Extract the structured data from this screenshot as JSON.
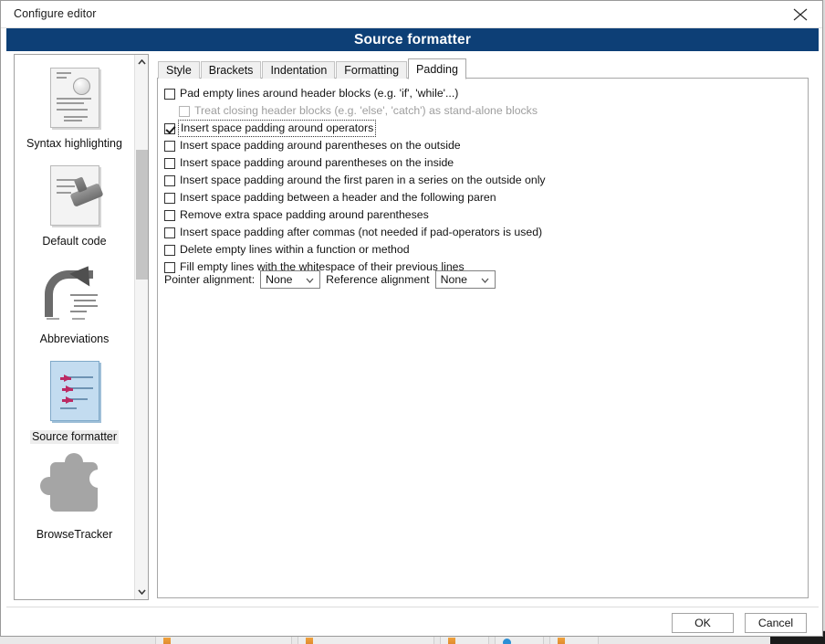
{
  "window": {
    "title": "Configure editor",
    "close_icon": "close-icon",
    "banner_title": "Source formatter"
  },
  "sidebar": {
    "items": [
      {
        "label": "Syntax highlighting",
        "icon": "syntax-highlighting-icon",
        "selected": false
      },
      {
        "label": "Default code",
        "icon": "default-code-icon",
        "selected": false
      },
      {
        "label": "Abbreviations",
        "icon": "abbreviations-icon",
        "selected": false
      },
      {
        "label": "Source formatter",
        "icon": "source-formatter-icon",
        "selected": true
      },
      {
        "label": "BrowseTracker",
        "icon": "browse-tracker-icon",
        "selected": false
      }
    ],
    "scrollbar": {
      "up_arrow": "chevron-up-icon",
      "down_arrow": "chevron-down-icon"
    }
  },
  "tabs": [
    {
      "label": "Style",
      "active": false
    },
    {
      "label": "Brackets",
      "active": false
    },
    {
      "label": "Indentation",
      "active": false
    },
    {
      "label": "Formatting",
      "active": false
    },
    {
      "label": "Padding",
      "active": true
    }
  ],
  "padding_options": [
    {
      "label": "Pad empty lines around header blocks (e.g. 'if', 'while'...)",
      "checked": false,
      "disabled": false,
      "indent": false,
      "focused": false
    },
    {
      "label": "Treat closing header blocks (e.g. 'else', 'catch') as stand-alone blocks",
      "checked": false,
      "disabled": true,
      "indent": true,
      "focused": false
    },
    {
      "label": "Insert space padding around operators",
      "checked": true,
      "disabled": false,
      "indent": false,
      "focused": true
    },
    {
      "label": "Insert space padding around parentheses on the outside",
      "checked": false,
      "disabled": false,
      "indent": false,
      "focused": false
    },
    {
      "label": "Insert space padding around parentheses on the inside",
      "checked": false,
      "disabled": false,
      "indent": false,
      "focused": false
    },
    {
      "label": "Insert space padding around the first paren in a series on the outside only",
      "checked": false,
      "disabled": false,
      "indent": false,
      "focused": false
    },
    {
      "label": "Insert space padding between a header and the following paren",
      "checked": false,
      "disabled": false,
      "indent": false,
      "focused": false
    },
    {
      "label": "Remove extra space padding around parentheses",
      "checked": false,
      "disabled": false,
      "indent": false,
      "focused": false
    },
    {
      "label": "Insert space padding after commas (not needed if pad-operators is used)",
      "checked": false,
      "disabled": false,
      "indent": false,
      "focused": false
    },
    {
      "label": "Delete empty lines within a function or method",
      "checked": false,
      "disabled": false,
      "indent": false,
      "focused": false
    },
    {
      "label": "Fill empty lines with the whitespace of their previous lines",
      "checked": false,
      "disabled": false,
      "indent": false,
      "focused": false
    }
  ],
  "alignment": {
    "pointer_label": "Pointer alignment:",
    "pointer_value": "None",
    "reference_label": "Reference alignment",
    "reference_value": "None"
  },
  "footer": {
    "ok_label": "OK",
    "cancel_label": "Cancel"
  },
  "colors": {
    "banner_blue": "#0d3f76",
    "dialog_bg": "#ffffff",
    "selected_label_bg": "#ededed"
  }
}
